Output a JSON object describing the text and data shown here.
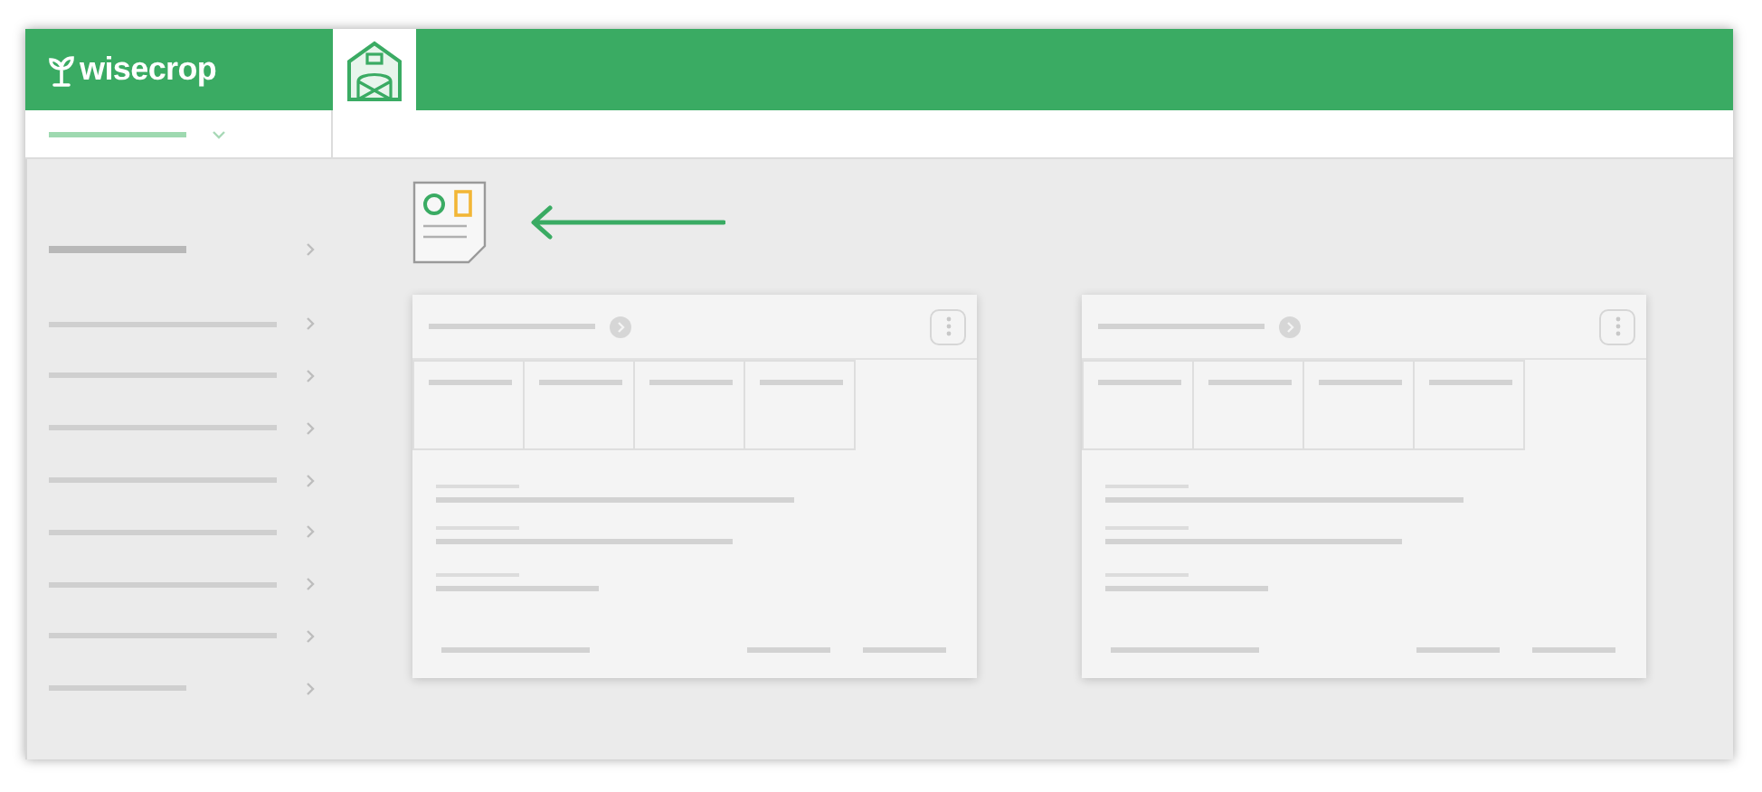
{
  "header": {
    "logo": "wisecrop"
  },
  "sidebar": {
    "items": [
      {
        "selected": true
      },
      {
        "selected": false
      },
      {
        "selected": false
      },
      {
        "selected": false
      },
      {
        "selected": false
      },
      {
        "selected": false
      },
      {
        "selected": false
      },
      {
        "selected": false
      },
      {
        "selected": false
      }
    ]
  }
}
